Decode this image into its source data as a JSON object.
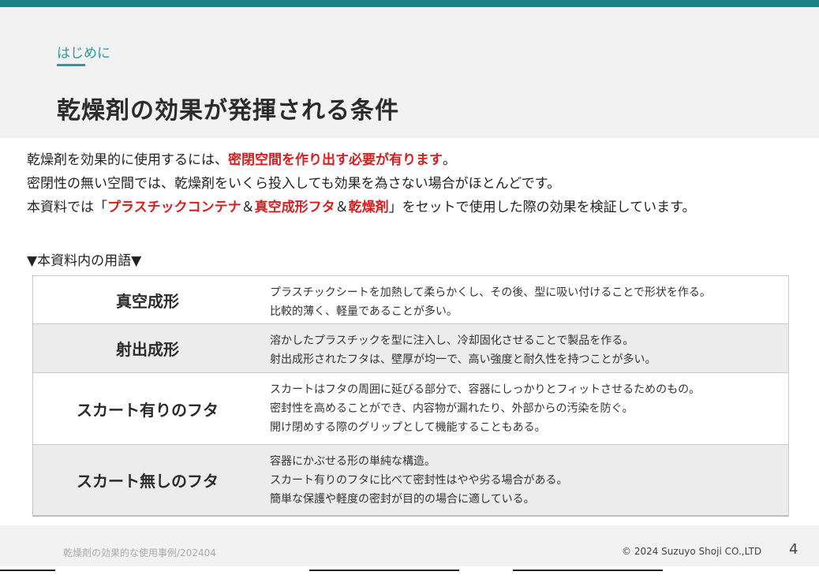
{
  "header": {
    "section_label": "はじめに",
    "title": "乾燥剤の効果が発揮される条件"
  },
  "intro": {
    "line1_pre": "乾燥剤を効果的に使用するには、",
    "line1_red": "密閉空間を作り出す必要が有ります",
    "line1_post": "。",
    "line2": "密閉性の無い空間では、乾燥剤をいくら投入しても効果を為さない場合がほとんどです。",
    "line3_pre": "本資料では「",
    "line3_red1": "プラスチックコンテナ",
    "line3_amp1": "＆",
    "line3_red2": "真空成形フタ",
    "line3_amp2": "＆",
    "line3_red3": "乾燥剤",
    "line3_post": "」をセットで使用した際の効果を検証しています。"
  },
  "terms_heading": "▼本資料内の用語▼",
  "terms": [
    {
      "term": "真空成形",
      "lines": [
        "プラスチックシートを加熱して柔らかくし、その後、型に吸い付けることで形状を作る。",
        "比較的薄く、軽量であることが多い。"
      ]
    },
    {
      "term": "射出成形",
      "lines": [
        "溶かしたプラスチックを型に注入し、冷却固化させることで製品を作る。",
        "射出成形されたフタは、壁厚が均一で、高い強度と耐久性を持つことが多い。"
      ]
    },
    {
      "term": "スカート有りのフタ",
      "lines": [
        "スカートはフタの周囲に延びる部分で、容器にしっかりとフィットさせるためのもの。",
        "密封性を高めることができ、内容物が漏れたり、外部からの汚染を防ぐ。",
        "開け閉めする際のグリップとして機能することもある。"
      ]
    },
    {
      "term": "スカート無しのフタ",
      "lines": [
        "容器にかぶせる形の単純な構造。",
        "スカート有りのフタに比べて密封性はやや劣る場合がある。",
        "簡単な保護や軽度の密封が目的の場合に適している。"
      ]
    }
  ],
  "footer": {
    "doc_name": "乾燥剤の効果的な使用事例/202404",
    "copyright": "© 2024 Suzuyo Shoji CO.,LTD",
    "page_number": "4"
  },
  "colors": {
    "accent_teal": "#1d8083",
    "highlight_red": "#d42020"
  }
}
